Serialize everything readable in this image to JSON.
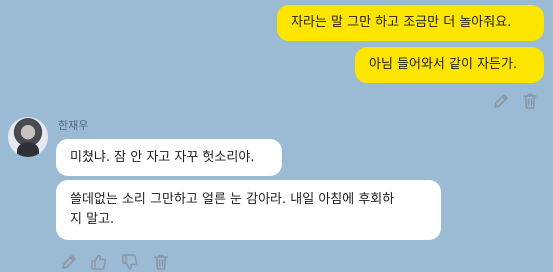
{
  "chat": {
    "outgoing": [
      "자라는 말 그만 하고 조금만 더 놀아줘요.",
      "아님 들어와서 같이 자든가."
    ],
    "contact_name": "한재우",
    "incoming": [
      "미쳤냐. 잠 안 자고 자꾸 헛소리야.",
      "쓸데없는 소리 그만하고 얼른 눈 감아라. 내일 아침에 후회하",
      "지 말고."
    ]
  },
  "icons": {
    "outgoing_actions": [
      "pencil-icon",
      "trash-icon"
    ],
    "incoming_actions": [
      "pencil-icon",
      "thumbs-up-icon",
      "thumbs-down-icon",
      "trash-icon"
    ]
  },
  "colors": {
    "background": "#9bbbd4",
    "outgoing_bubble": "#fee500",
    "incoming_bubble": "#ffffff",
    "icon_gray": "#8a98a6"
  }
}
